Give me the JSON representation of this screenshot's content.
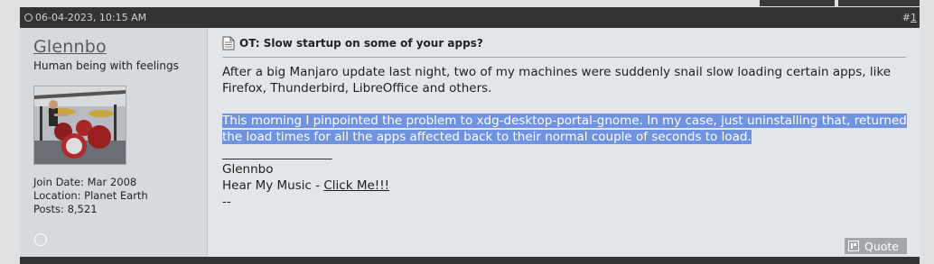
{
  "post": {
    "date": "06-04-2023, 10:15 AM",
    "number_prefix": "#",
    "number": "1"
  },
  "user": {
    "name": "Glennbo",
    "title": "Human being with feelings",
    "join_date": "Join Date: Mar 2008",
    "location": "Location: Planet Earth",
    "posts": "Posts: 8,521"
  },
  "message": {
    "title": "OT: Slow startup on some of your apps?",
    "paragraph1": "After a big Manjaro update last night, two of my machines were suddenly snail slow loading certain apps, like Firefox, Thunderbird, LibreOffice and others.",
    "paragraph2": "This morning I pinpointed the problem to xdg-desktop-portal-gnome. In my case, just uninstalling that, returned the load times for all the apps affected back to their normal couple of seconds to load."
  },
  "signature": {
    "separator": "__________________",
    "name": "Glennbo",
    "music_prefix": "Hear My Music - ",
    "music_link": "Click Me!!!",
    "dashes": "--"
  },
  "actions": {
    "quote_label": "Quote"
  }
}
